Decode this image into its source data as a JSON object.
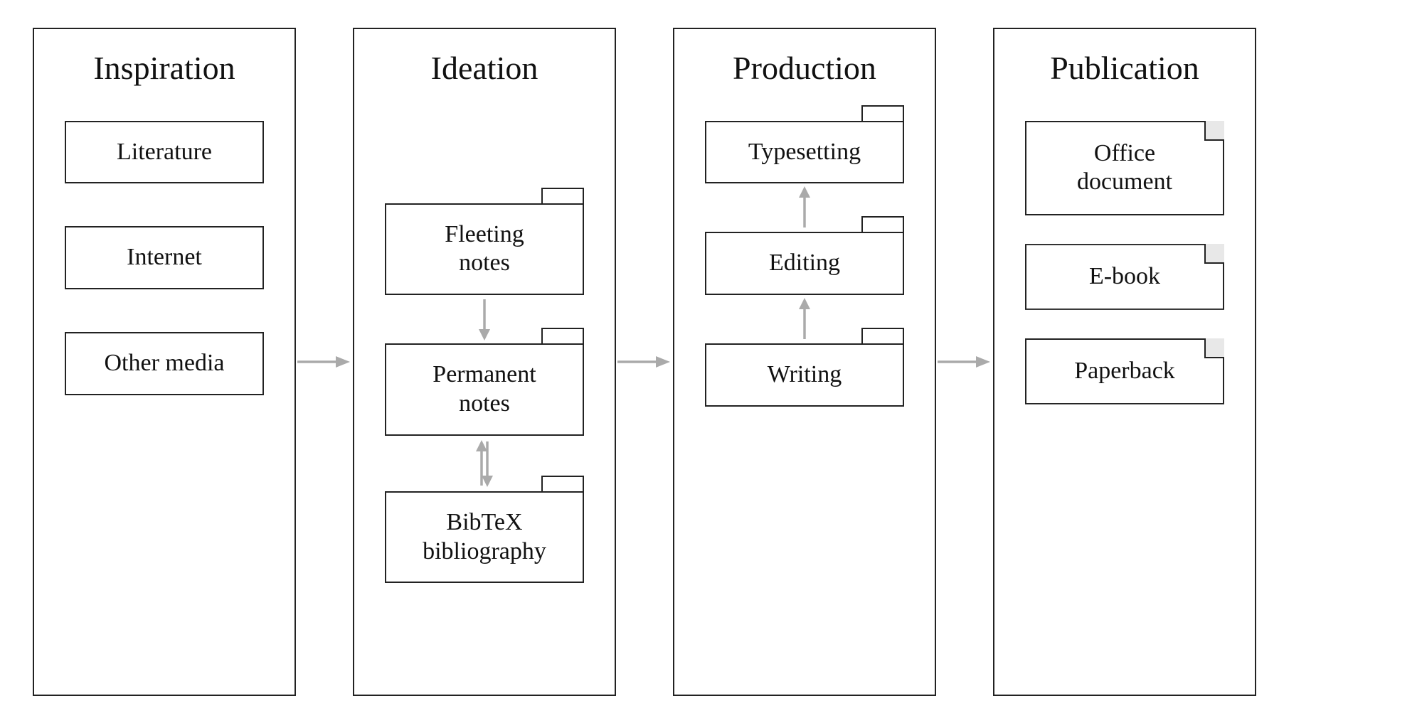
{
  "columns": [
    {
      "id": "inspiration",
      "title": "Inspiration",
      "nodes": [
        {
          "id": "literature",
          "type": "rect",
          "label": "Literature"
        },
        {
          "id": "internet",
          "type": "rect",
          "label": "Internet"
        },
        {
          "id": "other-media",
          "type": "rect",
          "label": "Other media"
        }
      ]
    },
    {
      "id": "ideation",
      "title": "Ideation",
      "nodes": [
        {
          "id": "fleeting-notes",
          "type": "folder",
          "label": "Fleeting\nnotes"
        },
        {
          "id": "permanent-notes",
          "type": "folder",
          "label": "Permanent\nnotes"
        },
        {
          "id": "bibtex-bibliography",
          "type": "folder",
          "label": "BibTeX\nbibliography"
        }
      ]
    },
    {
      "id": "production",
      "title": "Production",
      "nodes": [
        {
          "id": "typesetting",
          "type": "folder",
          "label": "Typesetting"
        },
        {
          "id": "editing",
          "type": "folder",
          "label": "Editing"
        },
        {
          "id": "writing",
          "type": "folder",
          "label": "Writing"
        }
      ]
    },
    {
      "id": "publication",
      "title": "Publication",
      "nodes": [
        {
          "id": "office-document",
          "type": "doc",
          "label": "Office\ndocument"
        },
        {
          "id": "e-book",
          "type": "doc",
          "label": "E-book"
        },
        {
          "id": "paperback",
          "type": "doc",
          "label": "Paperback"
        }
      ]
    }
  ],
  "arrows": {
    "horizontal": [
      {
        "from": "inspiration",
        "to": "ideation"
      },
      {
        "from": "ideation",
        "to": "production"
      },
      {
        "from": "production",
        "to": "publication"
      }
    ]
  },
  "arrowColor": "#aaa"
}
